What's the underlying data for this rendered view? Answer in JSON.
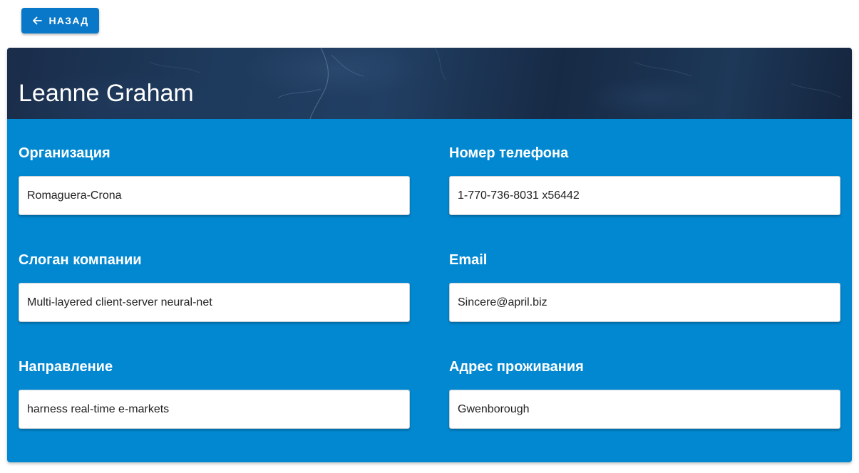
{
  "back_button": {
    "label": "НАЗАД",
    "icon": "arrow-left-icon"
  },
  "profile": {
    "name": "Leanne Graham"
  },
  "fields": [
    {
      "label": "Организация",
      "value": "Romaguera-Crona"
    },
    {
      "label": "Номер телефона",
      "value": "1-770-736-8031 x56442"
    },
    {
      "label": "Слоган компании",
      "value": "Multi-layered client-server neural-net"
    },
    {
      "label": "Email",
      "value": "Sincere@april.biz"
    },
    {
      "label": "Направление",
      "value": "harness real-time e-markets"
    },
    {
      "label": "Адрес проживания",
      "value": "Gwenborough"
    }
  ],
  "colors": {
    "button": "#0a78c8",
    "card": "#0288d1",
    "header": "#1e3a5c",
    "text_on_dark": "#ffffff"
  }
}
